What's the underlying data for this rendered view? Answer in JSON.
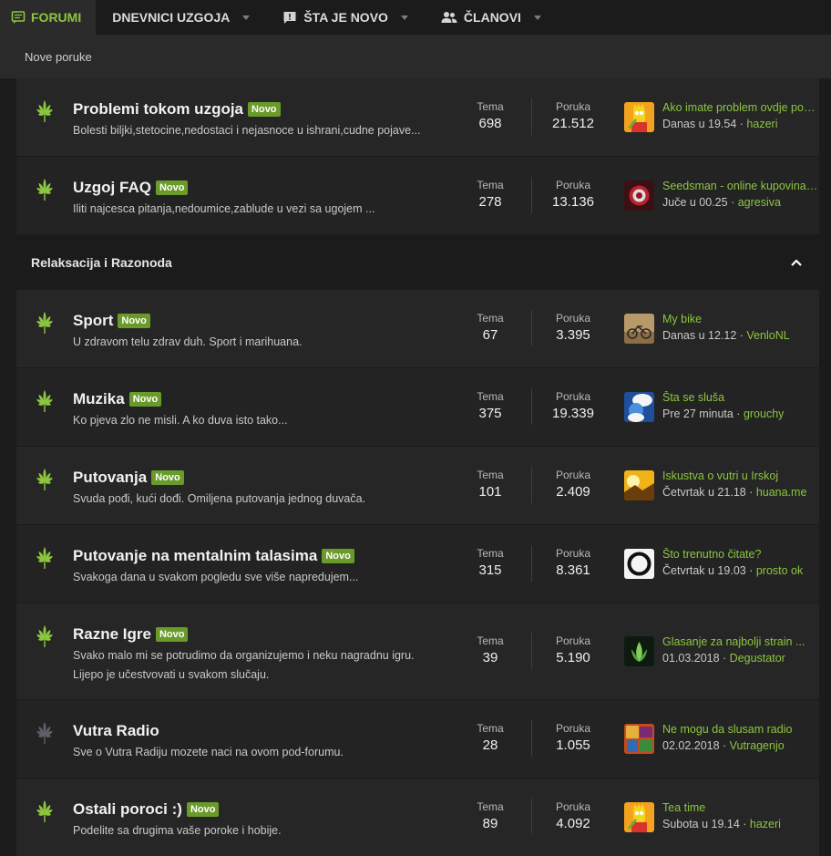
{
  "colors": {
    "accent": "#8cc63f",
    "badge": "#6a9b2a",
    "bg": "#1b1b1b"
  },
  "nav": {
    "tabs": [
      {
        "label": "FORUMI",
        "icon": "forum-message-icon"
      },
      {
        "label": "DNEVNICI UZGOJA",
        "icon": ""
      },
      {
        "label": "ŠTA JE NOVO",
        "icon": "alert-message-icon"
      },
      {
        "label": "ČLANOVI",
        "icon": "members-icon"
      }
    ],
    "sub": {
      "new_posts": "Nove poruke"
    }
  },
  "labels": {
    "tema": "Tema",
    "poruka": "Poruka",
    "novo": "Novo"
  },
  "category": {
    "title": "Relaksacija i Razonoda"
  },
  "forums": [
    {
      "title": "Problemi tokom uzgoja",
      "new": true,
      "desc": "Bolesti biljki,stetocine,nedostaci i nejasnoce u ishrani,cudne pojave...",
      "tema": "698",
      "poruka": "21.512",
      "last_thread": "Ako imate problem ovdje postavite",
      "last_time": "Danas u 19.54",
      "last_user": "hazeri",
      "avatar": "avatar-bart"
    },
    {
      "title": "Uzgoj FAQ",
      "new": true,
      "desc": "Iliti najcesca pitanja,nedoumice,zablude u vezi sa ugojem ...",
      "tema": "278",
      "poruka": "13.136",
      "last_thread": "Seedsman - online kupovina semena",
      "last_time": "Juče u 00.25",
      "last_user": "agresiva",
      "avatar": "avatar-flower"
    },
    {
      "title": "Sport",
      "new": true,
      "desc": "U zdravom telu zdrav duh. Sport i marihuana.",
      "tema": "67",
      "poruka": "3.395",
      "last_thread": "My bike",
      "last_time": "Danas u 12.12",
      "last_user": "VenloNL",
      "avatar": "avatar-bike"
    },
    {
      "title": "Muzika",
      "new": true,
      "desc": "Ko pjeva zlo ne misli. A ko duva isto tako...",
      "tema": "375",
      "poruka": "19.339",
      "last_thread": "Šta se sluša",
      "last_time": "Pre 27 minuta",
      "last_user": "grouchy",
      "avatar": "avatar-smurf"
    },
    {
      "title": "Putovanja",
      "new": true,
      "desc": "Svuda pođi, kući dođi. Omiljena putovanja jednog duvača.",
      "tema": "101",
      "poruka": "2.409",
      "last_thread": "Iskustva o vutri u Irskoj",
      "last_time": "Četvrtak u 21.18",
      "last_user": "huana.me",
      "avatar": "avatar-sunset"
    },
    {
      "title": "Putovanje na mentalnim talasima",
      "new": true,
      "desc": "Svakoga dana u svakom pogledu sve više napredujem...",
      "tema": "315",
      "poruka": "8.361",
      "last_thread": "Što trenutno čitate?",
      "last_time": "Četvrtak u 19.03",
      "last_user": "prosto ok",
      "avatar": "avatar-circle"
    },
    {
      "title": "Razne Igre",
      "new": true,
      "desc": "Svako malo mi se potrudimo da organizujemo i neku nagradnu igru. Lijepo je učestvovati u svakom slučaju.",
      "tema": "39",
      "poruka": "5.190",
      "last_thread": "Glasanje za najbolji strain ...",
      "last_time": "01.03.2018",
      "last_user": "Degustator",
      "avatar": "avatar-leaf"
    },
    {
      "title": "Vutra Radio",
      "new": false,
      "desc": "Sve o Vutra Radiju mozete naci na ovom pod-forumu.",
      "tema": "28",
      "poruka": "1.055",
      "last_thread": "Ne mogu da slusam radio",
      "last_time": "02.02.2018",
      "last_user": "Vutragenjo",
      "avatar": "avatar-collage"
    },
    {
      "title": "Ostali poroci :)",
      "new": true,
      "desc": "Podelite sa drugima vaše poroke i hobije.",
      "tema": "89",
      "poruka": "4.092",
      "last_thread": "Tea time",
      "last_time": "Subota u 19.14",
      "last_user": "hazeri",
      "avatar": "avatar-bart"
    }
  ]
}
